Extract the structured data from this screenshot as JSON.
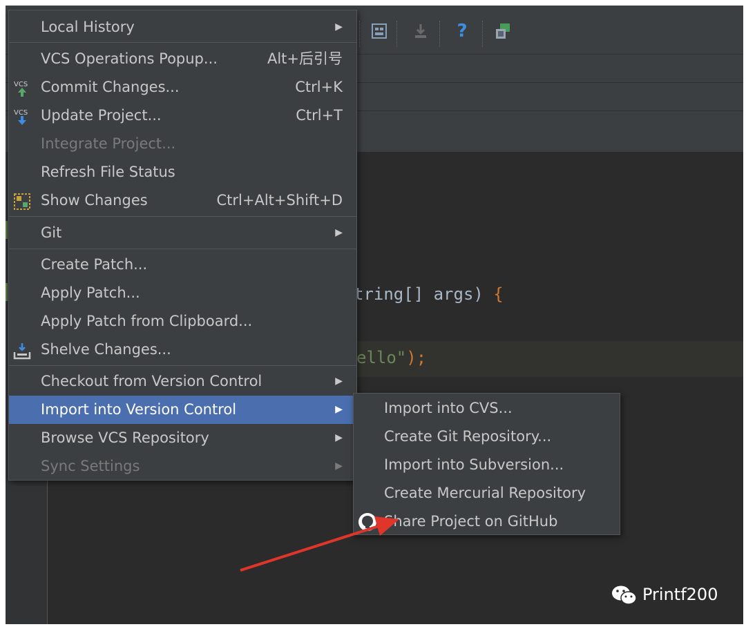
{
  "editor": {
    "code_line1_a": "tring[] args) ",
    "code_line1_b": "{",
    "code_line2_str": "ello\"",
    "code_line2_b": ");"
  },
  "menu": {
    "local_history": "Local History",
    "vcs_operations": "VCS Operations Popup...",
    "vcs_operations_sc": "Alt+后引号",
    "commit": "Commit Changes...",
    "commit_sc": "Ctrl+K",
    "update": "Update Project...",
    "update_sc": "Ctrl+T",
    "integrate": "Integrate Project...",
    "refresh": "Refresh File Status",
    "show_changes": "Show Changes",
    "show_changes_sc": "Ctrl+Alt+Shift+D",
    "git": "Git",
    "create_patch": "Create Patch...",
    "apply_patch": "Apply Patch...",
    "apply_patch_clip": "Apply Patch from Clipboard...",
    "shelve": "Shelve Changes...",
    "checkout": "Checkout from Version Control",
    "import_vc": "Import into Version Control",
    "browse": "Browse VCS Repository",
    "sync": "Sync Settings"
  },
  "submenu": {
    "import_cvs": "Import into CVS...",
    "create_git": "Create Git Repository...",
    "import_svn": "Import into Subversion...",
    "create_hg": "Create Mercurial Repository",
    "share_github": "Share Project on GitHub"
  },
  "watermark": "Printf200",
  "colors": {
    "selection": "#4b6eaf",
    "menu_bg": "#3c3f41",
    "editor_bg": "#2b2b2b",
    "arrow": "#e0352b"
  }
}
